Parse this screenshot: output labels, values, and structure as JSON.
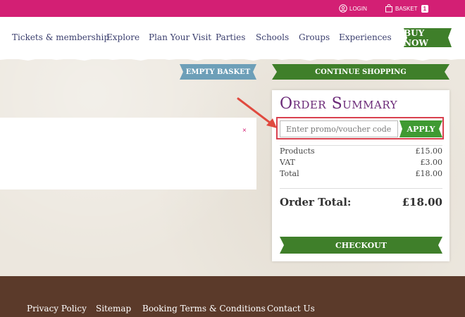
{
  "topbar": {
    "login_label": "LOGIN",
    "basket_label": "BASKET",
    "basket_count": "1",
    "bg_color": "#d31f74"
  },
  "nav": {
    "items": [
      "Tickets & membership",
      "Explore",
      "Plan Your Visit",
      "Parties",
      "Schools",
      "Groups",
      "Experiences"
    ],
    "buy_now": "BUY NOW"
  },
  "actions": {
    "empty_basket": "EMPTY BASKET",
    "continue_shopping": "CONTINUE SHOPPING"
  },
  "card": {
    "close_symbol": "×"
  },
  "summary": {
    "title": "Order Summary",
    "promo_placeholder": "Enter promo/voucher code h",
    "apply_label": "APPLY",
    "rows": [
      {
        "label": "Products",
        "value": "£15.00"
      },
      {
        "label": "VAT",
        "value": "£3.00"
      },
      {
        "label": "Total",
        "value": "£18.00"
      }
    ],
    "order_total_label": "Order Total:",
    "order_total_value": "£18.00",
    "checkout_label": "CHECKOUT"
  },
  "footer": {
    "links": [
      "Privacy Policy",
      "Sitemap",
      "Booking Terms & Conditions",
      "Contact Us"
    ]
  },
  "colors": {
    "green": "#3f7f2a",
    "blue": "#6d9fb8",
    "purple": "#6b2a78",
    "highlight": "#d9414f",
    "footer": "#5b3a2a"
  },
  "icons": [
    "user-icon",
    "bag-icon",
    "close-icon",
    "arrow-icon"
  ]
}
